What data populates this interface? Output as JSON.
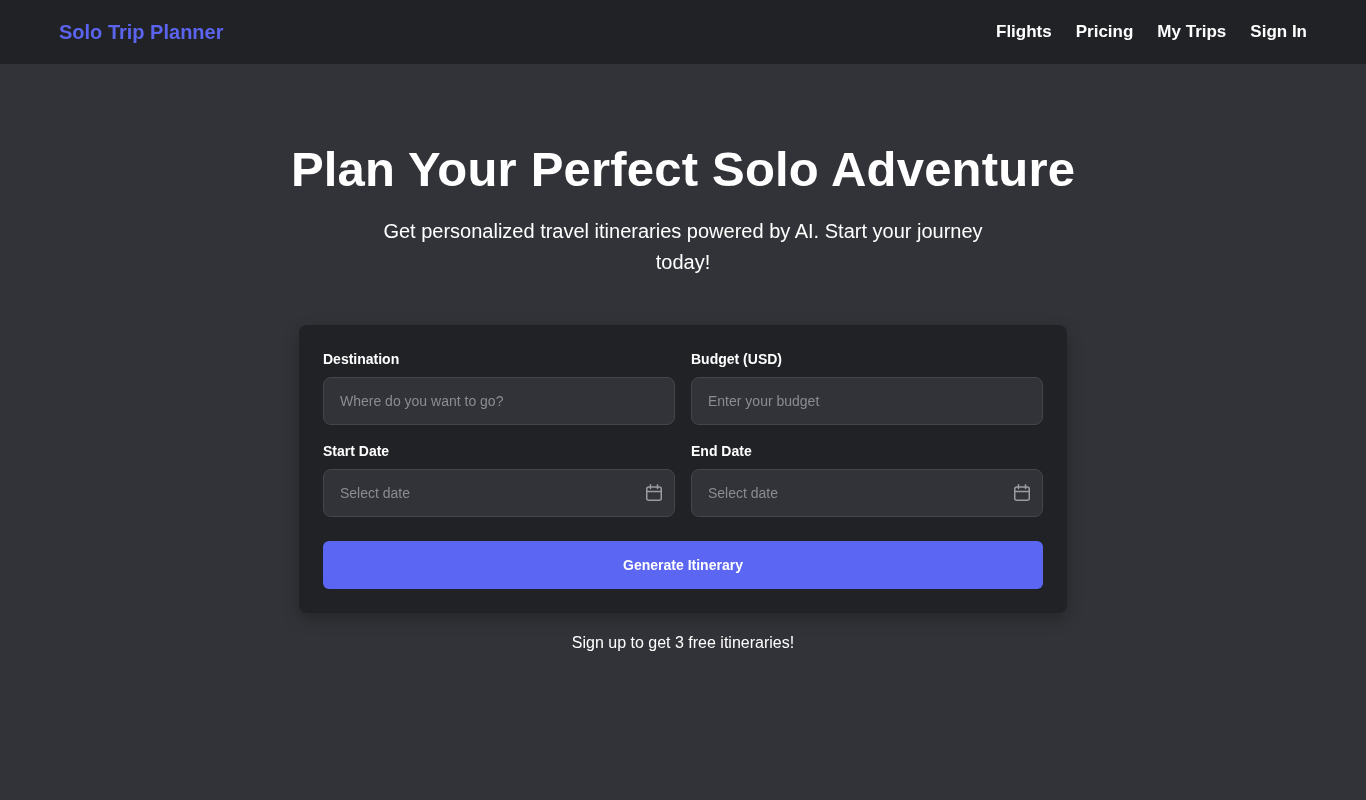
{
  "header": {
    "logo": "Solo Trip Planner",
    "nav": [
      "Flights",
      "Pricing",
      "My Trips",
      "Sign In"
    ]
  },
  "hero": {
    "title": "Plan Your Perfect Solo Adventure",
    "subtitle": "Get personalized travel itineraries powered by AI. Start your journey today!"
  },
  "form": {
    "fields": [
      {
        "label": "Destination",
        "placeholder": "Where do you want to go?",
        "kind": "text"
      },
      {
        "label": "Budget (USD)",
        "placeholder": "Enter your budget",
        "kind": "text"
      },
      {
        "label": "Start Date",
        "placeholder": "Select date",
        "kind": "date"
      },
      {
        "label": "End Date",
        "placeholder": "Select date",
        "kind": "date"
      }
    ],
    "button": "Generate Itinerary"
  },
  "signup_note": "Sign up to get 3 free itineraries!"
}
